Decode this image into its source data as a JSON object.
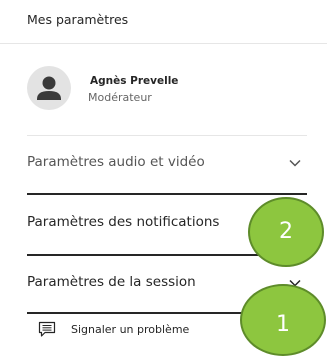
{
  "panel": {
    "title": "Mes paramètres"
  },
  "profile": {
    "name": "Agnès Prevelle",
    "role": "Modérateur",
    "avatar_icon": "user-avatar-icon"
  },
  "sections": [
    {
      "label": "Paramètres audio et vidéo",
      "icon": "chevron-down-icon"
    },
    {
      "label": "Paramètres des notifications",
      "icon": "chevron-down-icon"
    },
    {
      "label": "Paramètres de la session",
      "icon": "chevron-down-icon"
    }
  ],
  "report": {
    "label": "Signaler un problème",
    "icon": "comment-report-icon"
  },
  "callouts": [
    {
      "number": "2"
    },
    {
      "number": "1"
    }
  ],
  "colors": {
    "callout_fill": "#8dc63f",
    "callout_border": "#5e8c2a",
    "text": "#262626",
    "muted": "#666666"
  }
}
